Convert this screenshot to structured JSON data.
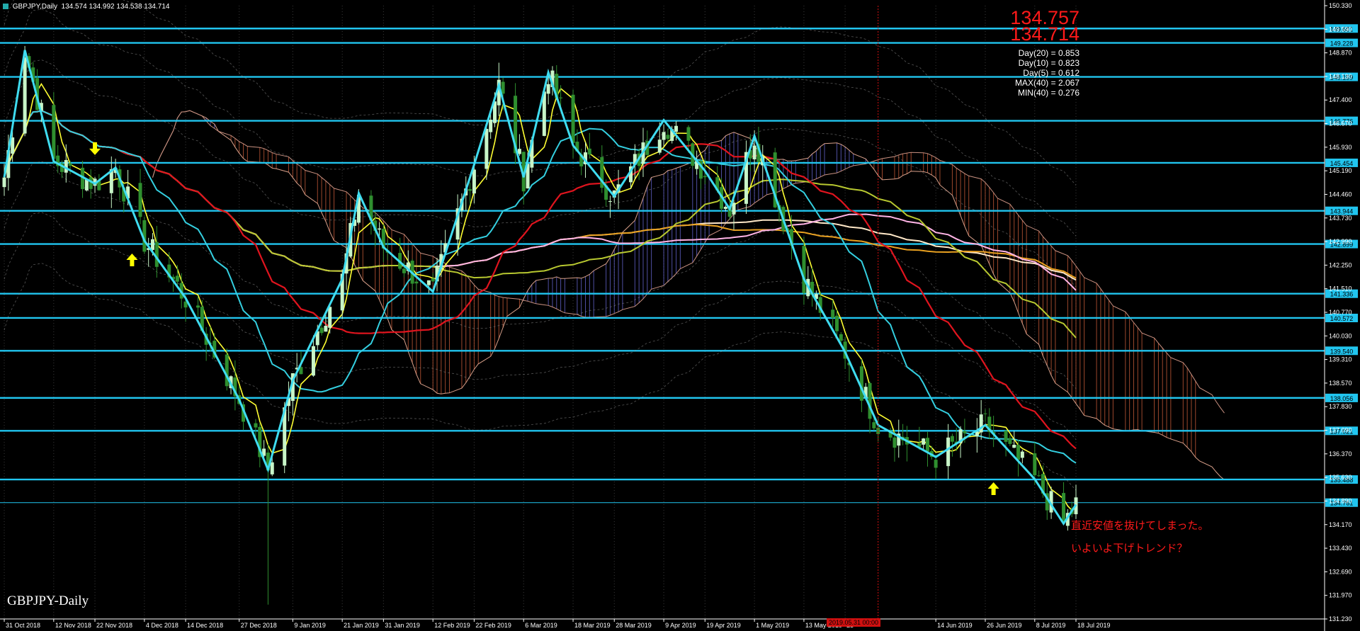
{
  "header": {
    "symbol_timeframe": "GBPJPY,Daily",
    "ohlc": "134.574 134.992 134.538 134.714"
  },
  "watermark": "GBPJPY-Daily",
  "info_panel": {
    "price_high": "134.757",
    "price_low": "134.714",
    "stats": [
      "Day(20) = 0.853",
      "Day(10) = 0.823",
      "Day(5) = 0.612",
      "MAX(40) = 2.067",
      "MIN(40) = 0.276"
    ]
  },
  "annotation": {
    "line1": "直近安値を抜けてしまった。",
    "line2": "いよいよ下げトレンド？"
  },
  "date_marker": "2019.05.31 00:00",
  "colors": {
    "background": "#000000",
    "bull_candle": "#c8f5c8",
    "bear_candle": "#2f8f2f",
    "level_line": "#21c5ef",
    "zigzag": "#3fdcf0",
    "ma_yellow": "#ffff33",
    "ma_red": "#e0141e",
    "ma_cyan": "#34cfe0",
    "ma_olive": "#b8c830",
    "ma_orange": "#e8a020",
    "ma_pink": "#ffb4e6",
    "ma_cream": "#ffe8c8",
    "cloud_bull": "#6a6ad8",
    "cloud_bear": "#d0603c",
    "vline_red": "#d01010",
    "arrow": "#ffff00",
    "annotation_text": "#ff1a1a",
    "price_big": "#ff1a1a"
  },
  "chart_data": {
    "type": "candlestick",
    "title": "GBPJPY-Daily",
    "x_ticks": [
      "31 Oct 2018",
      "12 Nov 2018",
      "22 Nov 2018",
      "4 Dec 2018",
      "14 Dec 2018",
      "27 Dec 2018",
      "9 Jan 2019",
      "21 Jan 2019",
      "31 Jan 2019",
      "12 Feb 2019",
      "22 Feb 2019",
      "6 Mar 2019",
      "18 Mar 2019",
      "28 Mar 2019",
      "9 Apr 2019",
      "19 Apr 2019",
      "1 May 2019",
      "13 May 2019",
      "23",
      "14 Jun 2019",
      "26 Jun 2019",
      "8 Jul 2019",
      "18 Jul 2019"
    ],
    "y_ticks": [
      "150.330",
      "149.590",
      "148.870",
      "148.130",
      "147.400",
      "146.670",
      "145.930",
      "145.190",
      "144.460",
      "143.730",
      "142.990",
      "142.250",
      "141.510",
      "140.770",
      "140.030",
      "139.310",
      "138.570",
      "137.830",
      "137.090",
      "136.370",
      "135.630",
      "134.890",
      "134.170",
      "133.430",
      "132.690",
      "131.970",
      "131.230"
    ],
    "ylim": [
      131.1,
      150.4
    ],
    "level_lines": [
      {
        "price": 149.681,
        "label": "149.681"
      },
      {
        "price": 149.228,
        "label": "149.228"
      },
      {
        "price": 148.159,
        "label": "148.159"
      },
      {
        "price": 146.776,
        "label": "146.776"
      },
      {
        "price": 145.454,
        "label": "145.454"
      },
      {
        "price": 143.944,
        "label": "143.944"
      },
      {
        "price": 142.899,
        "label": "142.899"
      },
      {
        "price": 141.336,
        "label": "141.336"
      },
      {
        "price": 140.572,
        "label": "140.572"
      },
      {
        "price": 139.54,
        "label": "139.540"
      },
      {
        "price": 138.056,
        "label": "138.056"
      },
      {
        "price": 137.021,
        "label": "137.021"
      },
      {
        "price": 135.488,
        "label": "135.488"
      },
      {
        "price": 134.761,
        "label": "134.761"
      }
    ],
    "key_points": [
      {
        "date": "31 Oct 2018",
        "price": 145.0
      },
      {
        "date": "5 Nov 2018",
        "price": 149.0
      },
      {
        "date": "12 Nov 2018",
        "price": 145.5
      },
      {
        "date": "22 Nov 2018",
        "price": 144.8
      },
      {
        "date": "27 Nov 2018",
        "price": 145.3
      },
      {
        "date": "4 Dec 2018",
        "price": 143.0
      },
      {
        "date": "14 Dec 2018",
        "price": 141.2
      },
      {
        "date": "27 Dec 2018",
        "price": 138.0
      },
      {
        "date": "3 Jan 2019",
        "price": 135.8
      },
      {
        "date": "9 Jan 2019",
        "price": 138.6
      },
      {
        "date": "21 Jan 2019",
        "price": 141.8
      },
      {
        "date": "25 Jan 2019",
        "price": 144.5
      },
      {
        "date": "31 Jan 2019",
        "price": 142.8
      },
      {
        "date": "12 Feb 2019",
        "price": 141.4
      },
      {
        "date": "22 Feb 2019",
        "price": 145.4
      },
      {
        "date": "28 Feb 2019",
        "price": 147.9
      },
      {
        "date": "6 Mar 2019",
        "price": 145.0
      },
      {
        "date": "12 Mar 2019",
        "price": 148.3
      },
      {
        "date": "18 Mar 2019",
        "price": 146.0
      },
      {
        "date": "28 Mar 2019",
        "price": 144.4
      },
      {
        "date": "9 Apr 2019",
        "price": 146.8
      },
      {
        "date": "19 Apr 2019",
        "price": 145.2
      },
      {
        "date": "25 Apr 2019",
        "price": 144.0
      },
      {
        "date": "1 May 2019",
        "price": 146.3
      },
      {
        "date": "13 May 2019",
        "price": 141.8
      },
      {
        "date": "23 May 2019",
        "price": 139.5
      },
      {
        "date": "31 May 2019",
        "price": 137.2
      },
      {
        "date": "14 Jun 2019",
        "price": 136.2
      },
      {
        "date": "26 Jun 2019",
        "price": 137.2
      },
      {
        "date": "8 Jul 2019",
        "price": 135.5
      },
      {
        "date": "15 Jul 2019",
        "price": 134.1
      },
      {
        "date": "18 Jul 2019",
        "price": 134.7
      }
    ]
  }
}
